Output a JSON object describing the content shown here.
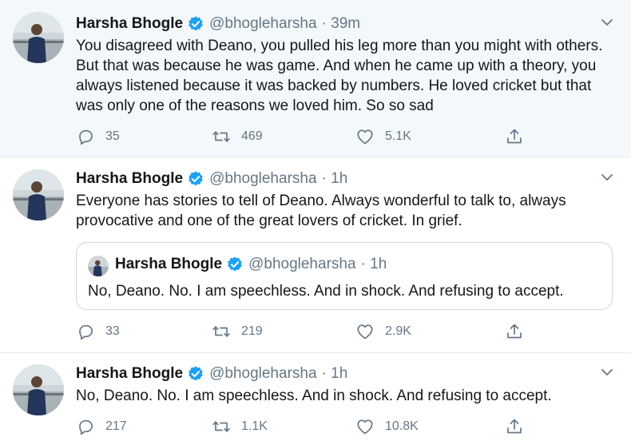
{
  "tweets": [
    {
      "name": "Harsha Bhogle",
      "handle": "@bhogleharsha",
      "time": "· 39m",
      "text": "You disagreed with Deano, you pulled his leg more than you might with others. But that was because he was game. And when he came up with a theory, you always listened because it was backed by numbers. He loved cricket but that was only one of the reasons we loved him. So so sad",
      "replies": "35",
      "retweets": "469",
      "likes": "5.1K"
    },
    {
      "name": "Harsha Bhogle",
      "handle": "@bhogleharsha",
      "time": "· 1h",
      "text": "Everyone has stories to tell of Deano. Always wonderful to talk to, always provocative and one of the great lovers of cricket. In grief.",
      "quote": {
        "name": "Harsha Bhogle",
        "handle": "@bhogleharsha",
        "time": "· 1h",
        "text": "No, Deano. No. I am speechless. And in shock. And refusing to accept."
      },
      "replies": "33",
      "retweets": "219",
      "likes": "2.9K"
    },
    {
      "name": "Harsha Bhogle",
      "handle": "@bhogleharsha",
      "time": "· 1h",
      "text": "No, Deano. No. I am speechless. And in shock. And refusing to accept.",
      "replies": "217",
      "retweets": "1.1K",
      "likes": "10.8K"
    }
  ],
  "icons": {
    "reply": "reply-icon",
    "retweet": "retweet-icon",
    "like": "heart-icon",
    "share": "share-icon",
    "verified": "verified-badge-icon",
    "more": "chevron-down-icon"
  },
  "colors": {
    "verified": "#1da1f2",
    "secondary_text": "#657786",
    "highlight_bg": "#f5f8fa"
  }
}
